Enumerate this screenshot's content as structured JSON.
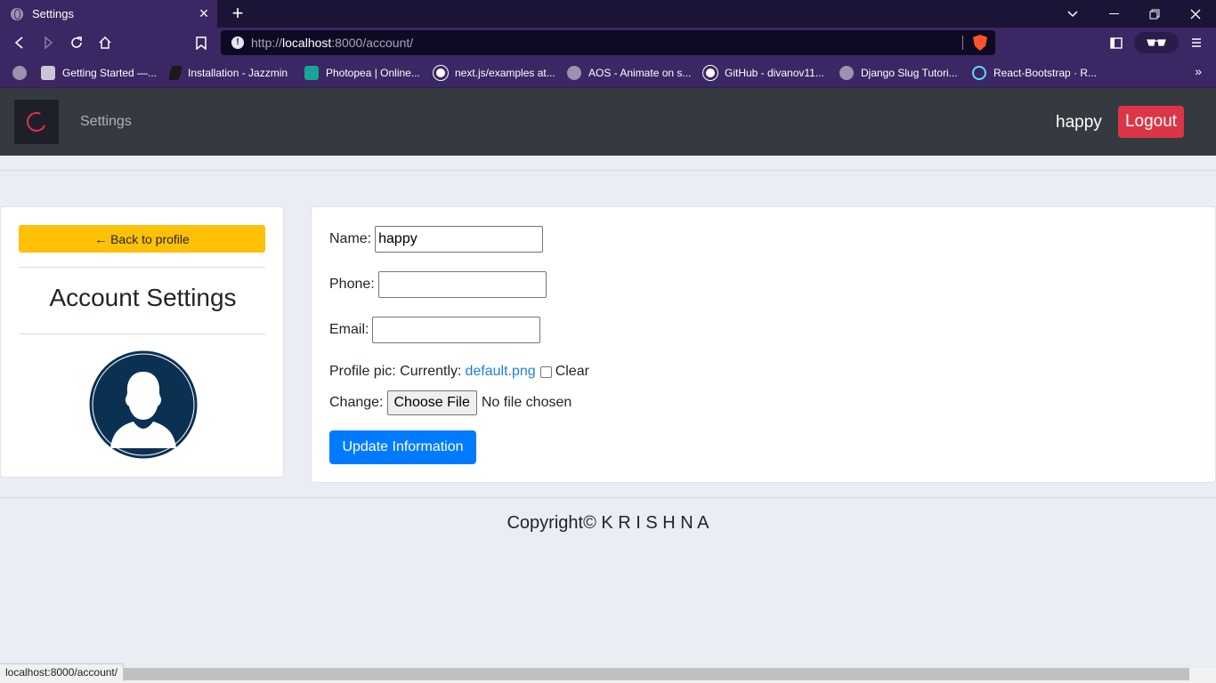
{
  "browser": {
    "tab_title": "Settings",
    "url_scheme": "http://",
    "url_host": "localhost",
    "url_rest": ":8000/account/",
    "bookmarks": [
      {
        "label": "Getting Started —...",
        "icon": "book-icon"
      },
      {
        "label": "Installation - Jazzmin",
        "icon": "jazzmin-icon"
      },
      {
        "label": "Photopea | Online...",
        "icon": "photopea-icon"
      },
      {
        "label": "next.js/examples at...",
        "icon": "github-icon"
      },
      {
        "label": "AOS - Animate on s...",
        "icon": "globe-icon"
      },
      {
        "label": "GitHub - divanov11...",
        "icon": "github-icon"
      },
      {
        "label": "Django Slug Tutori...",
        "icon": "globe-icon"
      },
      {
        "label": "React-Bootstrap · R...",
        "icon": "react-icon"
      }
    ],
    "status_url": "localhost:8000/account/"
  },
  "navbar": {
    "title": "Settings",
    "username": "happy",
    "logout_label": "Logout"
  },
  "sidebar": {
    "back_label": "← Back to profile",
    "heading": "Account Settings"
  },
  "form": {
    "name_label": "Name:",
    "name_value": "happy",
    "phone_label": "Phone:",
    "phone_value": "",
    "email_label": "Email:",
    "email_value": "",
    "pic_label": "Profile pic: Currently:",
    "pic_current": "default.png",
    "clear_label": "Clear",
    "change_label": "Change:",
    "choose_file_label": "Choose File",
    "no_file_label": "No file chosen",
    "submit_label": "Update Information"
  },
  "footer": {
    "copyright": "Copyright© K R I S H N A"
  },
  "colors": {
    "navbar_bg": "#343a40",
    "logout_bg": "#dc3545",
    "back_bg": "#ffc107",
    "submit_bg": "#007bff",
    "avatar_bg": "#0b3152",
    "browser_bg": "#3b2763"
  }
}
